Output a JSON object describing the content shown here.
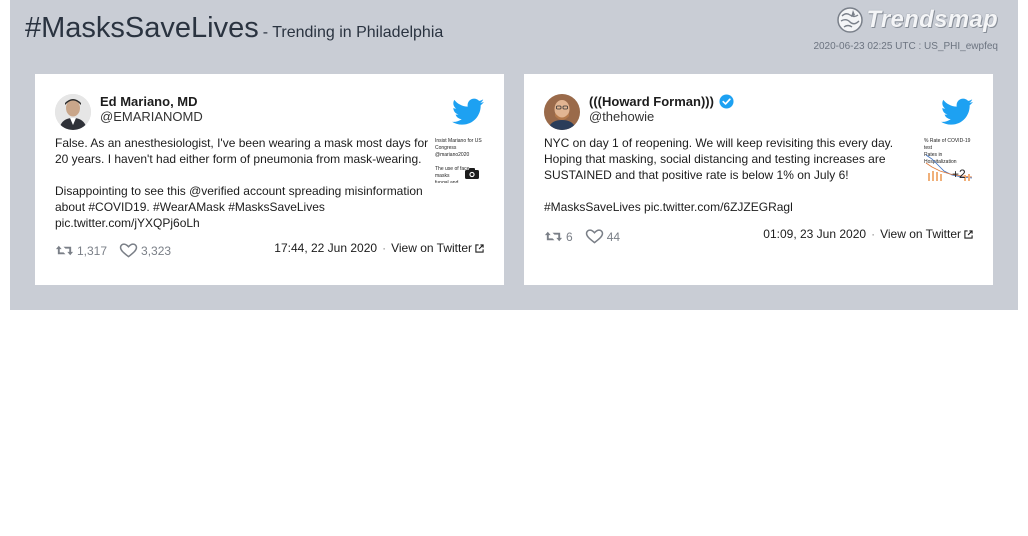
{
  "header": {
    "hashtag": "#MasksSaveLives",
    "subtitle": "- Trending in Philadelphia",
    "brand": "Trendsmap",
    "meta": "2020-06-23 02:25 UTC : US_PHI_ewpfeq"
  },
  "colors": {
    "panel_bg": "#c9cdd5",
    "twitter_blue": "#1da1f2",
    "text": "#1c1c1c"
  },
  "tweets": [
    {
      "author_name": "Ed Mariano, MD",
      "author_handle": "@EMARIANOMD",
      "verified": false,
      "text": "False. As an anesthesiologist, I've been wearing a mask most days for 20 years. I haven't had either form of pneumonia from mask-wearing.\n\nDisappointing to see this @verified account spreading misinformation about #COVID19. #WearAMask #MasksSaveLives\npic.twitter.com/jYXQPj6oLh",
      "thumb_text": "Insist Mariano for US Congress\n@mariano2020\n\nThe use of face masks\nfungal and...\nbility.\n#LieLess · Twitter...",
      "retweets": "1,317",
      "likes": "3,323",
      "timestamp": "17:44, 22 Jun 2020",
      "view_label": "View on Twitter",
      "media_icon": "camera-icon"
    },
    {
      "author_name": "(((Howard Forman)))",
      "author_handle": "@thehowie",
      "verified": true,
      "text": "NYC on day 1 of reopening. We will keep revisiting this every day. Hoping that masking, social distancing and testing increases are SUSTAINED and that positive rate is below 1% on July 6!\n\n#MasksSaveLives pic.twitter.com/6ZJZEGRagl",
      "thumb_text": "% Rate of COVID-19 test\nRates in Hospitalization",
      "extra_media": "+2",
      "retweets": "6",
      "likes": "44",
      "timestamp": "01:09, 23 Jun 2020",
      "view_label": "View on Twitter"
    }
  ]
}
